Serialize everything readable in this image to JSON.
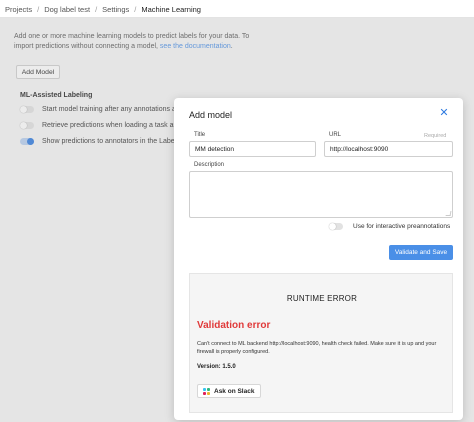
{
  "breadcrumb": {
    "items": [
      "Projects",
      "Dog label test",
      "Settings",
      "Machine Learning"
    ],
    "separator": "/"
  },
  "background": {
    "intro_text": "Add one or more machine learning models to predict labels for your data. To import predictions without connecting a model, ",
    "intro_link": "see the documentation",
    "intro_end": ".",
    "add_model_label": "Add Model",
    "ml_assisted_title": "ML-Assisted Labeling",
    "toggles": [
      {
        "label": "Start model training after any annotations are s",
        "on": false
      },
      {
        "label": "Retrieve predictions when loading a task autom",
        "on": false
      },
      {
        "label": "Show predictions to annotators in the Label St",
        "on": true
      }
    ]
  },
  "modal": {
    "title": "Add model",
    "close_icon": "close-icon",
    "title_label": "Title",
    "title_value": "MM detection",
    "url_label": "URL",
    "url_required": "Required",
    "url_value": "http://localhost:9090",
    "description_label": "Description",
    "description_value": "",
    "interactive_label": "Use for interactive preannotations",
    "interactive_on": false,
    "validate_label": "Validate and Save",
    "accent_color": "#4a8fe7"
  },
  "error": {
    "runtime_title": "RUNTIME ERROR",
    "validation_title": "Validation error",
    "message": "Can't connect to ML backend http://localhost:9090, health check failed. Make sure it is up and your firewall is properly configured.",
    "version": "Version: 1.5.0",
    "slack_label": "Ask on Slack",
    "slack_icon": "slack-icon",
    "error_color": "#e03a3a"
  }
}
